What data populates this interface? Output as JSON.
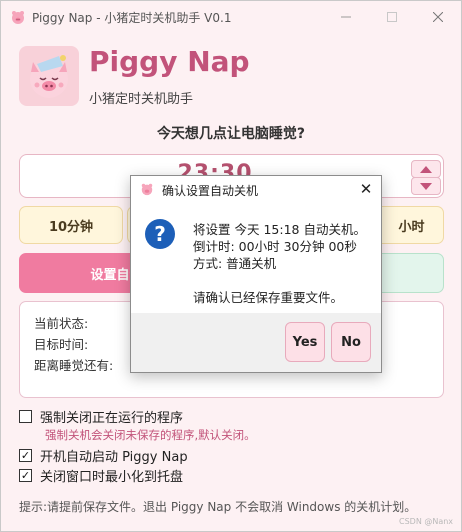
{
  "window": {
    "title": "Piggy Nap - 小猪定时关机助手 V0.1",
    "controls": [
      "minimize",
      "maximize",
      "close"
    ]
  },
  "header": {
    "brand": "Piggy Nap",
    "subtitle": "小猪定时关机助手",
    "question": "今天想几点让电脑睡觉?"
  },
  "time_picker": {
    "value": "23:30"
  },
  "presets": {
    "p10": "10分钟",
    "last": "小时"
  },
  "actions": {
    "set_label": "设置自动"
  },
  "status": {
    "current_state_label": "当前状态:",
    "target_time_label": "目标时间:",
    "remaining_label": "距离睡觉还有:"
  },
  "options": {
    "force_close": {
      "label": "强制关闭正在运行的程序",
      "checked": false
    },
    "force_close_note": "强制关机会关闭未保存的程序,默认关闭。",
    "autostart": {
      "label": "开机自动启动 Piggy Nap",
      "checked": true
    },
    "minimize_to_tray": {
      "label": "关闭窗口时最小化到托盘",
      "checked": true
    },
    "check_mark": "✓"
  },
  "hint": "提示:请提前保存文件。退出 Piggy Nap 不会取消 Windows 的关机计划。",
  "watermark": "CSDN @Nanx",
  "dialog": {
    "title": "确认设置自动关机",
    "close_glyph": "✕",
    "icon": "?",
    "line1": "将设置 今天 15:18 自动关机。",
    "line2": "倒计时: 00小时 30分钟 00秒",
    "line3": "方式: 普通关机",
    "line4": "请确认已经保存重要文件。",
    "yes_label": "Yes",
    "no_label": "No"
  },
  "colors": {
    "accent": "#c2537a",
    "background": "#fdf1f3",
    "primary_button": "#f07ba0",
    "preset_bg": "#fff6dc",
    "info_icon": "#1d5fb8"
  }
}
